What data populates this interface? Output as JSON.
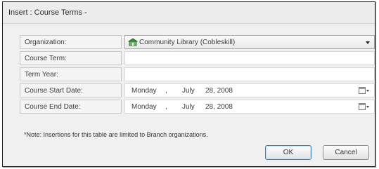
{
  "dialog": {
    "title": "Insert : Course Terms -"
  },
  "form": {
    "organization": {
      "label": "Organization:",
      "value": "Community Library (Cobleskill)"
    },
    "course_term": {
      "label": "Course Term:",
      "value": ""
    },
    "term_year": {
      "label": "Term Year:",
      "value": ""
    },
    "start_date": {
      "label": "Course Start Date:",
      "weekday": "Monday",
      "sep": ",",
      "month": "July",
      "day_year": "28, 2008"
    },
    "end_date": {
      "label": "Course End Date:",
      "weekday": "Monday",
      "sep": ",",
      "month": "July",
      "day_year": "28, 2008"
    }
  },
  "note": "*Note: Insertions for this table are limited to Branch organizations.",
  "buttons": {
    "ok": "OK",
    "cancel": "Cancel"
  },
  "colors": {
    "dialog_bg": "#f0f0f0",
    "ok_border": "#3c7fb1"
  }
}
